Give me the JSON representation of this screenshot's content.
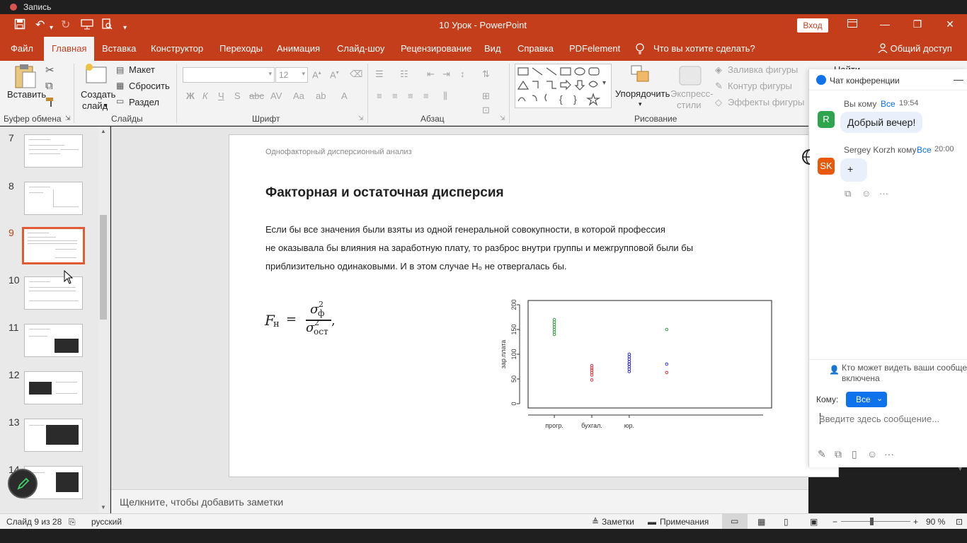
{
  "recording": {
    "label": "Запись"
  },
  "titlebar": {
    "title": "10 Урок  -  PowerPoint",
    "signin": "Вход"
  },
  "tabs": [
    {
      "label": "Файл"
    },
    {
      "label": "Главная"
    },
    {
      "label": "Вставка"
    },
    {
      "label": "Конструктор"
    },
    {
      "label": "Переходы"
    },
    {
      "label": "Анимация"
    },
    {
      "label": "Слайд-шоу"
    },
    {
      "label": "Рецензирование"
    },
    {
      "label": "Вид"
    },
    {
      "label": "Справка"
    },
    {
      "label": "PDFelement"
    },
    {
      "label": "Что вы хотите сделать?"
    }
  ],
  "share_label": "Общий доступ",
  "ribbon": {
    "clipboard": {
      "paste": "Вставить",
      "group": "Буфер обмена"
    },
    "slides": {
      "create_line1": "Создать",
      "create_line2": "слайд",
      "layout": "Макет",
      "reset": "Сбросить",
      "section": "Раздел",
      "group": "Слайды"
    },
    "font": {
      "size": "12",
      "bold": "Ж",
      "italic": "К",
      "underline": "Ч",
      "strike": "S",
      "group": "Шрифт"
    },
    "paragraph": {
      "group": "Абзац"
    },
    "drawing": {
      "arrange_line1": "Упорядочить",
      "express_line1": "Экспресс-",
      "express_line2": "стили",
      "fill": "Заливка фигуры",
      "outline": "Контур фигуры",
      "effects": "Эффекты фигуры",
      "find": "Найти",
      "group": "Рисование"
    }
  },
  "thumbnails": {
    "items": [
      {
        "num": "7"
      },
      {
        "num": "8"
      },
      {
        "num": "9"
      },
      {
        "num": "10"
      },
      {
        "num": "11"
      },
      {
        "num": "12"
      },
      {
        "num": "13"
      },
      {
        "num": "14"
      }
    ],
    "selected": "9"
  },
  "slide": {
    "breadcrumb": "Однофакторный дисперсионный анализ",
    "title": "Факторная и остаточная дисперсия",
    "paragraph_lines": [
      "Если бы все значения были взяты из одной генеральной совокупности, в которой профессия",
      "не оказывала бы влияния на заработную плату, то разброс внутри группы и межгрупповой были бы",
      "приблизительно одинаковыми. И в этом случае H₀ не отвергалась бы."
    ],
    "formula": {
      "lhs": "F",
      "lhs_sub": "н",
      "num_sym": "σ",
      "num_sub": "ф",
      "num_sup": "2",
      "den_sym": "σ",
      "den_sub": "ост",
      "den_sup": "2"
    }
  },
  "chart_data": {
    "type": "scatter",
    "ylabel": "зар.плата",
    "xlabel": "",
    "categories": [
      "прогр.",
      "бухгал.",
      "юр."
    ],
    "yticks": [
      "0",
      "50",
      "100",
      "150",
      "200"
    ],
    "ylim": [
      0,
      200
    ],
    "series": [
      {
        "color": "#2e9e3e",
        "x": [
          1,
          1,
          1,
          1,
          1,
          1,
          1,
          4
        ],
        "y": [
          140,
          145,
          150,
          155,
          160,
          165,
          170,
          150
        ]
      },
      {
        "color": "#d9303a",
        "x": [
          2,
          2,
          2,
          2,
          2,
          2,
          4
        ],
        "y": [
          48,
          58,
          63,
          68,
          72,
          77,
          63
        ]
      },
      {
        "color": "#2b2bd6",
        "x": [
          3,
          3,
          3,
          3,
          3,
          3,
          3,
          3,
          3,
          4
        ],
        "y": [
          65,
          70,
          75,
          80,
          85,
          90,
          95,
          100,
          80,
          80
        ]
      }
    ]
  },
  "notes": {
    "placeholder": "Щелкните, чтобы добавить заметки"
  },
  "status": {
    "slide": "Слайд 9 из 28",
    "lang": "русский",
    "notes": "Заметки",
    "comments": "Примечания",
    "zoom": "90 %"
  },
  "chat": {
    "title": "Чат конференции",
    "messages": [
      {
        "sender": "Вы кому",
        "to": "Все",
        "time": "19:54",
        "avatar": "R",
        "avatar_color": "#2ea44f",
        "text": "Добрый вечер!"
      },
      {
        "sender": "Sergey Korzh кому",
        "to": "Все",
        "time": "20:00",
        "avatar": "SK",
        "avatar_color": "#e8590c",
        "text": "+"
      }
    ],
    "visibility_note": "Кто может видеть ваши сообще",
    "visibility_note2": "включена",
    "to_label": "Кому:",
    "to_value": "Все",
    "input_placeholder": "Введите здесь сообщение..."
  }
}
